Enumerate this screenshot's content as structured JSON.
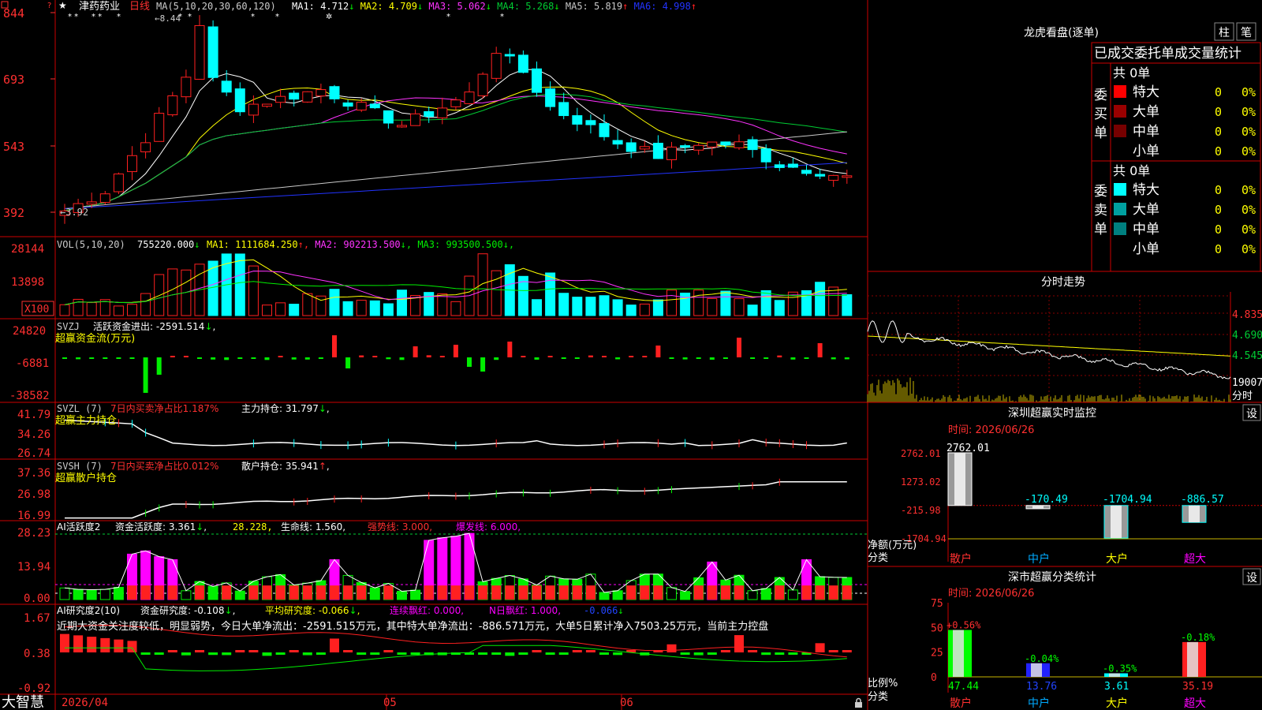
{
  "app": {
    "brand": "大智慧"
  },
  "colors": {
    "up": "#ff2020",
    "down": "#00ffff",
    "grid": "#cc0000",
    "ma1": "#ffffff",
    "ma2": "#ffff00",
    "ma3": "#ff33ff",
    "ma4": "#00cc33",
    "ma5": "#c8c8c8",
    "ma6": "#2233ff",
    "green": "#00ee00",
    "magenta": "#ff00ff"
  },
  "main_panel": {
    "stock_name": "津药药业",
    "period": "日线",
    "ma_title": "MA(5,10,20,30,60,120)",
    "ma_values": [
      {
        "label": "MA1: 4.712",
        "arrow": "↓",
        "color": "#ffffff"
      },
      {
        "label": "MA2: 4.709",
        "arrow": "↓",
        "color": "#ffff00"
      },
      {
        "label": "MA3: 5.062",
        "arrow": "↓",
        "color": "#ff33ff"
      },
      {
        "label": "MA4: 5.268",
        "arrow": "↓",
        "color": "#00cc33"
      },
      {
        "label": "MA5: 5.819",
        "arrow": "↑",
        "color": "#c8c8c8"
      },
      {
        "label": "MA6: 4.998",
        "arrow": "↑",
        "color": "#2233ff"
      }
    ],
    "high_label": "8.44",
    "low_label": "3.92",
    "y_ticks": [
      "844",
      "693",
      "543",
      "392"
    ],
    "y_values": [
      844,
      693,
      543,
      392
    ]
  },
  "vol_panel": {
    "title": "VOL(5,10,20)",
    "value": "755220.000",
    "items": [
      {
        "label": "MA1: 1111684.250",
        "arrow": "↑",
        "color": "#ffff00"
      },
      {
        "label": "MA2: 902213.500",
        "arrow": "↓",
        "color": "#ff33ff"
      },
      {
        "label": "MA3: 993500.500",
        "arrow": "↓",
        "color": "#00ee00"
      }
    ],
    "y_ticks": [
      "28144",
      "13898"
    ],
    "multiplier": "X100"
  },
  "svzj_panel": {
    "title": "SVZJ",
    "text": "活跃资金进出: -2591.514",
    "arrow": "↓",
    "subtitle": "超赢资金流(万元)",
    "y_ticks": [
      "24820",
      "-6881",
      "-38582"
    ]
  },
  "svzl_panel": {
    "title": "SVZL (7)",
    "red_text": "7日内买卖净占比1.187%",
    "label": "主力持仓: 31.797",
    "arrow": "↓",
    "subtitle": "超赢主力持仓",
    "y_ticks": [
      "41.79",
      "34.26",
      "26.74"
    ]
  },
  "svsh_panel": {
    "title": "SVSH (7)",
    "red_text": "7日内买卖净占比0.012%",
    "label": "散户持仓: 35.941",
    "arrow": "↑",
    "subtitle": "超赢散户持仓",
    "y_ticks": [
      "37.36",
      "26.98",
      "16.99"
    ]
  },
  "ai_active_panel": {
    "title": "AI活跃度2",
    "label1": "资金活跃度: 3.361",
    "arrow1": "↓",
    "value2": "28.228",
    "label3": "生命线: 1.560",
    "strong_line": "强势线: 3.000",
    "burst_line": "爆发线: 6.000",
    "y_ticks": [
      "28.23",
      "13.94",
      "0.00"
    ]
  },
  "ai_research_panel": {
    "title": "AI研究度2(10)",
    "label1": "资金研究度: -0.108",
    "arrow1": "↓",
    "label2": "平均研究度: -0.066",
    "arrow2": "↓",
    "label3": "连续飘红: 0.000",
    "label4": "N日飘红: 1.000",
    "label5": "-0.066",
    "arrow5": "↓",
    "commentary": "近期大资金关注度较低，明显弱势，今日大单净流出：-2591.515万元，其中特大单净流出：-886.571万元，大单5日累计净入7503.25万元，当前主力控盘",
    "y_ticks": [
      "1.67",
      "0.38",
      "-0.92"
    ]
  },
  "x_axis": {
    "labels": [
      "2026/04",
      "05",
      "06"
    ]
  },
  "right_panel": {
    "lhb": {
      "title": "龙虎看盘(逐单)",
      "btn_bar": "柱",
      "btn_line": "笔",
      "header": "已成交委托单成交量统计",
      "buy_group": "委买单",
      "sell_group": "委卖单",
      "buy_total": "共 0单",
      "sell_total": "共 0单",
      "buy_rows": [
        {
          "name": "特大",
          "count": "0",
          "pct": "0%",
          "color": "#ff0000"
        },
        {
          "name": "大单",
          "count": "0",
          "pct": "0%",
          "color": "#990000"
        },
        {
          "name": "中单",
          "count": "0",
          "pct": "0%",
          "color": "#770000"
        },
        {
          "name": "小单",
          "count": "0",
          "pct": "0%",
          "color": ""
        }
      ],
      "sell_rows": [
        {
          "name": "特大",
          "count": "0",
          "pct": "0%",
          "color": "#00ffff"
        },
        {
          "name": "大单",
          "count": "0",
          "pct": "0%",
          "color": "#00a0a0"
        },
        {
          "name": "中单",
          "count": "0",
          "pct": "0%",
          "color": "#008080"
        },
        {
          "name": "小单",
          "count": "0",
          "pct": "0%",
          "color": ""
        }
      ]
    },
    "intraday": {
      "title": "分时走势",
      "y_ticks": [
        "4.835",
        "4.690",
        "4.545"
      ],
      "vol_label": "19007",
      "vol_unit": "分时"
    },
    "sz_monitor": {
      "title": "深圳超赢实时监控",
      "set_btn": "设",
      "time": "时间: 2026/06/26",
      "y_ticks": [
        "2762.01",
        "1273.02",
        "-215.98",
        "-1704.94"
      ],
      "axis_title": "净额(万元)",
      "cat_title": "分类",
      "chart_data": {
        "type": "bar",
        "categories": [
          "散户",
          "中户",
          "大户",
          "超大"
        ],
        "values": [
          2762.01,
          -170.49,
          -1704.94,
          -886.57
        ],
        "value_labels": [
          "2762.01",
          "-170.49",
          "-1704.94",
          "-886.57"
        ],
        "ylim": [
          -1704.94,
          2762.01
        ]
      }
    },
    "sz_stats": {
      "title": "深市超赢分类统计",
      "set_btn": "设",
      "time": "时间: 2026/06/26",
      "y_ticks": [
        "75",
        "50",
        "25",
        "0"
      ],
      "axis_title": "比例%",
      "cat_title": "分类",
      "chart_data": {
        "type": "bar",
        "categories": [
          "散户",
          "中户",
          "大户",
          "超大"
        ],
        "values": [
          47.44,
          13.76,
          3.61,
          35.19
        ],
        "value_labels": [
          "47.44",
          "13.76",
          "3.61",
          "35.19"
        ],
        "changes": [
          "+0.56%",
          "-0.04%",
          "-0.35%",
          "-0.18%"
        ],
        "ylim": [
          0,
          75
        ]
      }
    }
  }
}
